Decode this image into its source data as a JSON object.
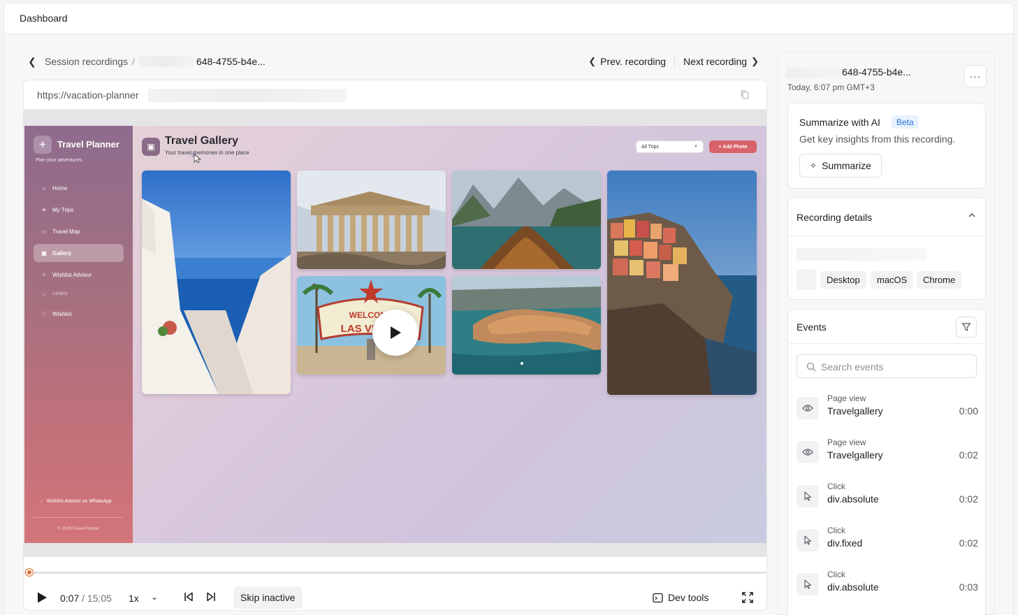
{
  "header": {
    "title": "Dashboard"
  },
  "breadcrumb": {
    "parent": "Session recordings",
    "separator": "/",
    "current": "648-4755-b4e..."
  },
  "recording_nav": {
    "prev": "Prev. recording",
    "next": "Next recording"
  },
  "player": {
    "url": "https://vacation-planner",
    "time_current": "0:07",
    "time_separator": " / ",
    "time_total": "15:05",
    "progress": 0.008,
    "speed": "1x",
    "skip_inactive": "Skip inactive",
    "dev_tools": "Dev tools"
  },
  "app": {
    "brand": "Travel Planner",
    "tagline": "Plan your adventures",
    "nav": [
      {
        "label": "Home",
        "icon": "home-icon"
      },
      {
        "label": "My Trips",
        "icon": "plane-icon"
      },
      {
        "label": "Travel Map",
        "icon": "map-icon"
      },
      {
        "label": "Gallery",
        "icon": "image-icon",
        "active": true
      },
      {
        "label": "Wishlist Advisor",
        "icon": "sparkle-icon"
      }
    ],
    "admin_label": "ADMIN",
    "wishlist_label": "Wishlist",
    "whatsapp_label": "Wishlist Advisor on WhatsApp",
    "footer": "© 2026 Travel Planner",
    "page_title": "Travel Gallery",
    "page_subtitle": "Your travel memories in one place",
    "filter_value": "All Trips",
    "add_button": "+ Add Photo",
    "colors": {
      "accent": "#d8636a",
      "sidebar_top": "#8e6b8e",
      "sidebar_bottom": "#d3757a"
    }
  },
  "panel": {
    "recording_id": "648-4755-b4e...",
    "timestamp": "Today, 6:07 pm GMT+3",
    "more": "···",
    "ai": {
      "title": "Summarize with AI",
      "badge": "Beta",
      "description": "Get key insights from this recording.",
      "button": "Summarize"
    },
    "details": {
      "title": "Recording details",
      "chips": [
        "Desktop",
        "macOS",
        "Chrome"
      ]
    },
    "events": {
      "title": "Events",
      "search_placeholder": "Search events",
      "items": [
        {
          "kind": "Page view",
          "name": "Travelgallery",
          "time": "0:00",
          "icon": "eye-icon"
        },
        {
          "kind": "Page view",
          "name": "Travelgallery",
          "time": "0:02",
          "icon": "eye-icon"
        },
        {
          "kind": "Click",
          "name": "div.absolute",
          "time": "0:02",
          "icon": "cursor-icon"
        },
        {
          "kind": "Click",
          "name": "div.fixed",
          "time": "0:02",
          "icon": "cursor-icon"
        },
        {
          "kind": "Click",
          "name": "div.absolute",
          "time": "0:03",
          "icon": "cursor-icon"
        }
      ]
    }
  }
}
